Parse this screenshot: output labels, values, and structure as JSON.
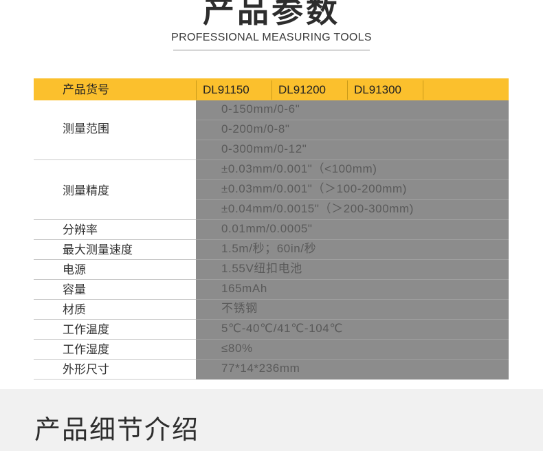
{
  "header": {
    "title": "产品参数",
    "subtitle": "PROFESSIONAL MEASURING TOOLS"
  },
  "table": {
    "columns": [
      "产品货号",
      "DL91150",
      "DL91200",
      "DL91300"
    ],
    "rows": [
      {
        "label": "测量范围",
        "values": [
          "0-150mm/0-6\"",
          "0-200m/0-8\"",
          "0-300mm/0-12\""
        ]
      },
      {
        "label": "测量精度",
        "values": [
          "±0.03mm/0.001\"（<100mm)",
          "±0.03mm/0.001\"（＞100-200mm)",
          "±0.04mm/0.0015\"（＞200-300mm)"
        ]
      },
      {
        "label": "分辨率",
        "values": [
          "0.01mm/0.0005\""
        ]
      },
      {
        "label": "最大测量速度",
        "values": [
          "1.5m/秒；60in/秒"
        ]
      },
      {
        "label": "电源",
        "values": [
          "1.55V纽扣电池"
        ]
      },
      {
        "label": "容量",
        "values": [
          "165mAh"
        ]
      },
      {
        "label": "材质",
        "values": [
          "不锈钢"
        ]
      },
      {
        "label": "工作温度",
        "values": [
          "5℃-40℃/41℃-104℃"
        ]
      },
      {
        "label": "工作湿度",
        "values": [
          "≤80%"
        ]
      },
      {
        "label": "外形尺寸",
        "values": [
          "77*14*236mm"
        ]
      }
    ]
  },
  "section": {
    "title": "产品细节介绍"
  },
  "colors": {
    "header_bar": "#fbc02d",
    "value_column": "#8c8c8c",
    "bottom_band": "#f1f1f1"
  }
}
